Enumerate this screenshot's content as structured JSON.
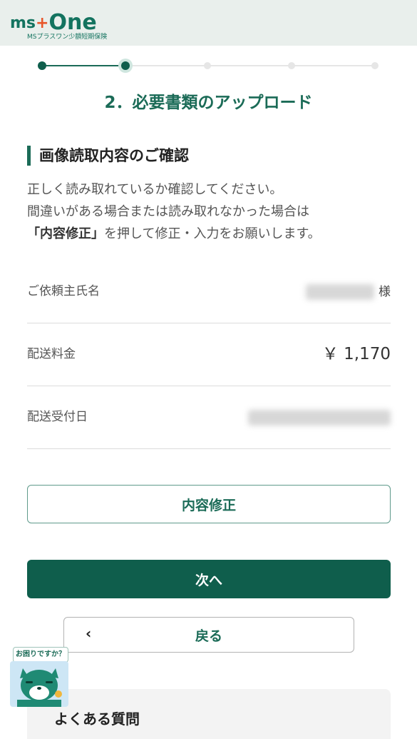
{
  "header": {
    "logo_text_a": "ms",
    "logo_plus": "+",
    "logo_text_b": "One",
    "logo_sub": "MSプラスワン少額短期保険"
  },
  "stepper": {
    "total_steps": 5,
    "current_step": 2
  },
  "step_title": "2．必要書類のアップロード",
  "section": {
    "title": "画像読取内容のご確認",
    "desc_line1": "正しく読み取れているか確認してください。",
    "desc_line2": "間違いがある場合または読み取れなかった場合は",
    "desc_line3_bold": "「内容修正」",
    "desc_line3_rest": "を押して修正・入力をお願いします。"
  },
  "rows": {
    "requester_label": "ご依頼主氏名",
    "requester_suffix": "様",
    "fee_label": "配送料金",
    "fee_value": "￥ 1,170",
    "date_label": "配送受付日"
  },
  "buttons": {
    "edit": "内容修正",
    "next": "次へ",
    "back": "戻る",
    "back_chevron": "‹"
  },
  "help": {
    "bubble": "お困りですか？"
  },
  "faq": {
    "title": "よくある質問"
  },
  "colors": {
    "brand": "#0f5e4c",
    "accent": "#1b6b57",
    "logo_plus": "#e8562a"
  }
}
